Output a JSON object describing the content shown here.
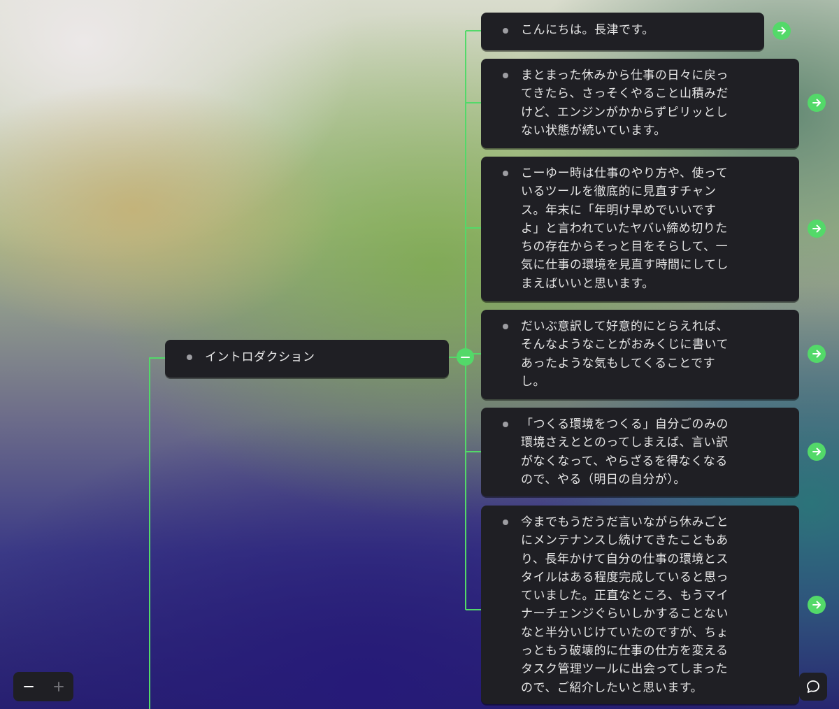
{
  "colors": {
    "accent_green": "#53d969",
    "node_bg": "#1f1f24",
    "node_text": "#e6e6e6",
    "bullet": "#9d9da2"
  },
  "root_node": {
    "label": "イントロダクション"
  },
  "child_nodes": [
    {
      "text": "こんにちは。長津です。"
    },
    {
      "text": "まとまった休みから仕事の日々に戻ってきたら、さっそくやること山積みだけど、エンジンがかからずピリッとしない状態が続いています。"
    },
    {
      "text": "こーゆー時は仕事のやり方や、使っているツールを徹底的に見直すチャンス。年末に「年明け早めでいいですよ」と言われていたヤバい締め切りたちの存在からそっと目をそらして、一気に仕事の環境を見直す時間にしてしまえばいいと思います。"
    },
    {
      "text": "だいぶ意訳して好意的にとらえれば、そんなようなことがおみくじに書いてあったような気もしてくることです し。"
    },
    {
      "text": "「つくる環境をつくる」自分ごのみの環境さえととのってしまえば、言い訳がなくなって、やらざるを得なくなるので、やる（明日の自分が）。"
    },
    {
      "text": "今までもうだうだ言いながら休みごとにメンテナンスし続けてきたこともあり、長年かけて自分の仕事の環境とスタイルはある程度完成していると思っていました。正直なところ、もうマイナーチェンジぐらいしかすることないなと半分いじけていたのですが、ちょっともう破壊的に仕事の仕方を変えるタスク管理ツールに出会ってしまったので、ご紹介したいと思います。"
    }
  ],
  "icons": {
    "open_node": "arrow-right-icon",
    "collapse": "minus-icon",
    "zoom_out": "minus-icon",
    "zoom_in": "plus-icon",
    "chat": "chat-bubble-icon"
  }
}
